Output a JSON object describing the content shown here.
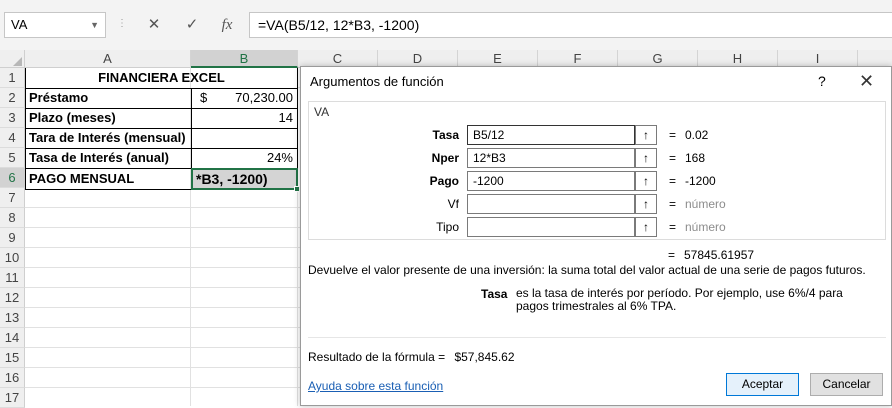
{
  "formula_bar": {
    "name_box": "VA",
    "cancel_icon": "✕",
    "enter_icon": "✓",
    "fx_label": "fx",
    "formula": "=VA(B5/12, 12*B3, -1200)"
  },
  "columns": [
    "A",
    "B",
    "C",
    "D",
    "E",
    "F",
    "G",
    "H",
    "I"
  ],
  "selected_column": "B",
  "rows": [
    "1",
    "2",
    "3",
    "4",
    "5",
    "6",
    "7",
    "8",
    "9",
    "10",
    "11",
    "12",
    "13",
    "14",
    "15",
    "16",
    "17"
  ],
  "selected_row": "6",
  "cells": {
    "A1": "FINANCIERA EXCEL",
    "A2": "Préstamo",
    "B2_currency": "$",
    "B2_value": "70,230.00",
    "A3": "Plazo (meses)",
    "B3": "14",
    "A4": "Tara de Interés (mensual)",
    "A5": "Tasa de Interés (anual)",
    "B5": "24%",
    "A6": "PAGO MENSUAL",
    "B6": "*B3, -1200)"
  },
  "dialog": {
    "title": "Argumentos de función",
    "help_icon": "?",
    "close_icon": "✕",
    "function_name": "VA",
    "arguments": [
      {
        "label": "Tasa",
        "value": "B5/12",
        "result": "0.02"
      },
      {
        "label": "Nper",
        "value": "12*B3",
        "result": "168"
      },
      {
        "label": "Pago",
        "value": "-1200",
        "result": "-1200"
      },
      {
        "label": "Vf",
        "value": "",
        "result": "número"
      },
      {
        "label": "Tipo",
        "value": "",
        "result": "número"
      }
    ],
    "ref_button_icon": "↑",
    "equals": "=",
    "function_result": "57845.61957",
    "description": "Devuelve el valor presente de una inversión: la suma total del valor actual de una serie de pagos futuros.",
    "arg_help_name": "Tasa",
    "arg_help_text": "es la tasa de interés por período. Por ejemplo, use 6%/4 para pagos trimestrales al 6% TPA.",
    "formula_result_label": "Resultado de la fórmula =",
    "formula_result_value": "$57,845.62",
    "help_link": "Ayuda sobre esta función",
    "ok_label": "Aceptar",
    "cancel_label": "Cancelar"
  },
  "colors": {
    "accent_green": "#217346",
    "link_blue": "#1a5fb4"
  }
}
